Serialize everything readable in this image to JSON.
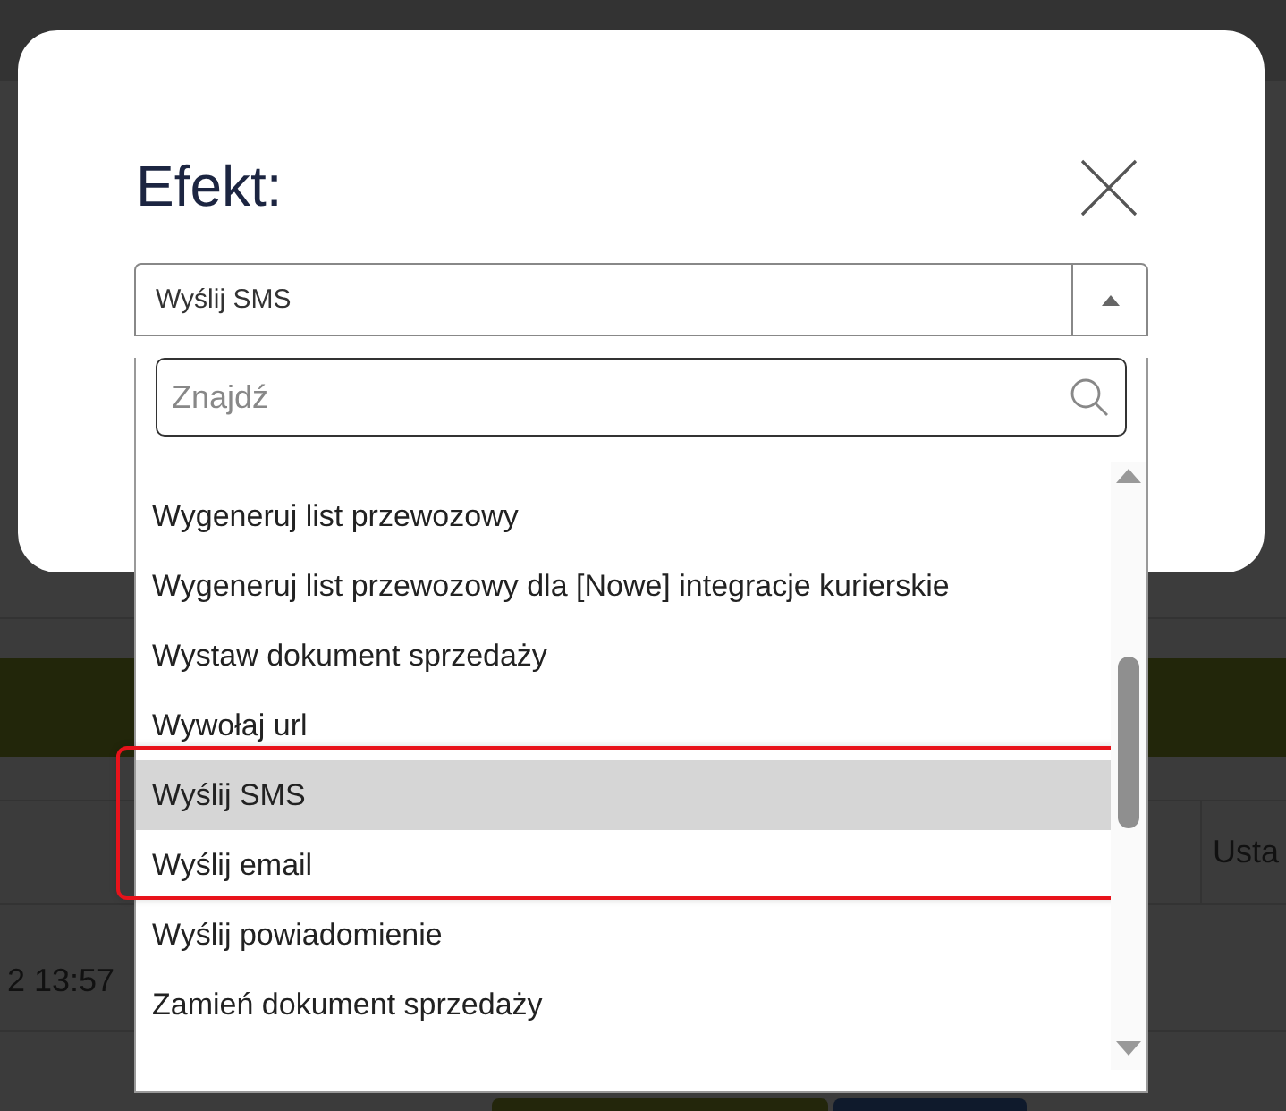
{
  "background": {
    "row_texts": [
      {
        "text": "2 13:57"
      }
    ],
    "column_header": "Usta"
  },
  "dialog": {
    "title": "Efekt:",
    "select": {
      "value": "Wyślij SMS",
      "expanded": true
    },
    "search": {
      "placeholder": "Znajdź"
    },
    "options": [
      {
        "label": "Wygeneruj list przewozowy",
        "selected": false,
        "highlighted": false
      },
      {
        "label": "Wygeneruj list przewozowy dla [Nowe] integracje kurierskie",
        "selected": false,
        "highlighted": false
      },
      {
        "label": "Wystaw dokument sprzedaży",
        "selected": false,
        "highlighted": false
      },
      {
        "label": "Wywołaj url",
        "selected": false,
        "highlighted": false
      },
      {
        "label": "Wyślij SMS",
        "selected": true,
        "highlighted": true
      },
      {
        "label": "Wyślij email",
        "selected": false,
        "highlighted": true
      },
      {
        "label": "Wyślij powiadomienie",
        "selected": false,
        "highlighted": false
      },
      {
        "label": "Zamień dokument sprzedaży",
        "selected": false,
        "highlighted": false
      }
    ]
  }
}
